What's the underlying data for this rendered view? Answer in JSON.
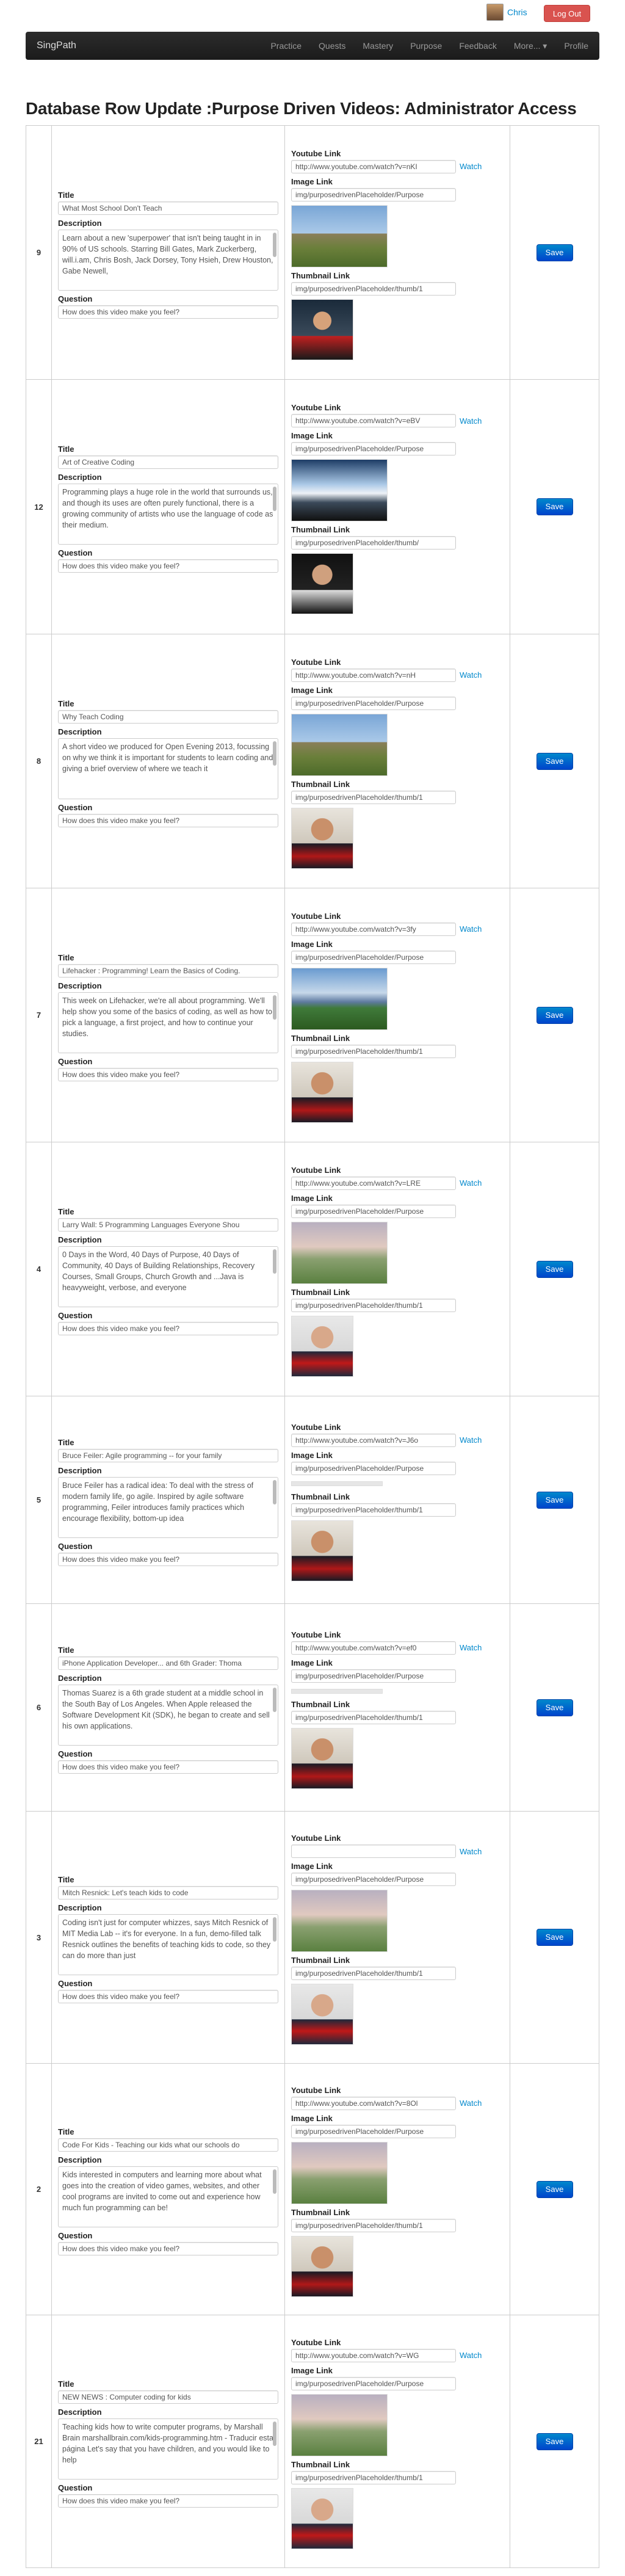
{
  "user": {
    "name": "Chris",
    "logout_label": "Log Out"
  },
  "nav": {
    "brand": "SingPath",
    "items": [
      "Practice",
      "Quests",
      "Mastery",
      "Purpose",
      "Feedback",
      "More... ▾",
      "Profile"
    ]
  },
  "page_title": "Database Row Update :Purpose Driven Videos: Administrator Access",
  "labels": {
    "title": "Title",
    "description": "Description",
    "question": "Question",
    "youtube": "Youtube Link",
    "image": "Image Link",
    "thumbnail": "Thumbnail Link",
    "watch": "Watch",
    "save": "Save"
  },
  "rows": [
    {
      "id": "9",
      "title": "What Most School Don't Teach",
      "description": "Learn about a new 'superpower' that isn't being taught in in 90% of US schools. Starring Bill Gates, Mark Zuckerberg, will.i.am, Chris Bosh, Jack Dorsey, Tony Hsieh, Drew Houston, Gabe Newell,",
      "question": "How does this video make you feel?",
      "youtube": "http://www.youtube.com/watch?v=nKI",
      "image": "img/purposedrivenPlaceholder/Purpose",
      "thumbnail": "img/purposedrivenPlaceholder/thumb/1",
      "image_state": "scene-a",
      "thumb_state": "p1"
    },
    {
      "id": "12",
      "title": "Art of Creative Coding",
      "description": "Programming plays a huge role in the world that surrounds us, and though its uses are often purely functional, there is a growing community of artists who use the language of code as their medium.",
      "question": "How does this video make you feel?",
      "youtube": "http://www.youtube.com/watch?v=eBV",
      "image": "img/purposedrivenPlaceholder/Purpose",
      "thumbnail": "img/purposedrivenPlaceholder/thumb/",
      "image_state": "scene-b",
      "thumb_state": "p2"
    },
    {
      "id": "8",
      "title": "Why Teach Coding",
      "description": "A short video we produced for Open Evening 2013, focussing on why we think it is important for students to learn coding and giving a brief overview of where we teach it",
      "question": "How does this video make you feel?",
      "youtube": "http://www.youtube.com/watch?v=nH",
      "image": "img/purposedrivenPlaceholder/Purpose",
      "thumbnail": "img/purposedrivenPlaceholder/thumb/1",
      "image_state": "scene-a",
      "thumb_state": "p3"
    },
    {
      "id": "7",
      "title": "Lifehacker : Programming! Learn the Basics of Coding.",
      "description": "This week on Lifehacker, we're all about programming. We'll help show you some of the basics of coding, as well as how to pick a language, a first project, and how to continue your studies.",
      "question": "How does this video make you feel?",
      "youtube": "http://www.youtube.com/watch?v=3fy",
      "image": "img/purposedrivenPlaceholder/Purpose",
      "thumbnail": "img/purposedrivenPlaceholder/thumb/1",
      "image_state": "scene-c",
      "thumb_state": "p3"
    },
    {
      "id": "4",
      "title": "Larry Wall: 5 Programming Languages Everyone Shou",
      "description": "0 Days in the Word, 40 Days of Purpose, 40 Days of Community, 40 Days of Building Relationships, Recovery Courses, Small Groups, Church Growth and ...Java is heavyweight, verbose, and everyone",
      "question": "How does this video make you feel?",
      "youtube": "http://www.youtube.com/watch?v=LRE",
      "image": "img/purposedrivenPlaceholder/Purpose",
      "thumbnail": "img/purposedrivenPlaceholder/thumb/1",
      "image_state": "scene-d",
      "thumb_state": "p4"
    },
    {
      "id": "5",
      "title": "Bruce Feiler: Agile programming -- for your family",
      "description": "Bruce Feiler has a radical idea: To deal with the stress of modern family life, go agile. Inspired by agile software programming, Feiler introduces family practices which encourage flexibility, bottom-up idea",
      "question": "How does this video make you feel?",
      "youtube": "http://www.youtube.com/watch?v=J6o",
      "image": "img/purposedrivenPlaceholder/Purpose",
      "thumbnail": "img/purposedrivenPlaceholder/thumb/1",
      "image_state": "placeholder",
      "thumb_state": "p3"
    },
    {
      "id": "6",
      "title": "iPhone Application Developer... and 6th Grader: Thoma",
      "description": "Thomas Suarez is a 6th grade student at a middle school in the South Bay of Los Angeles. When Apple released the Software Development Kit (SDK), he began to create and sell his own applications.",
      "question": "How does this video make you feel?",
      "youtube": "http://www.youtube.com/watch?v=ef0",
      "image": "img/purposedrivenPlaceholder/Purpose",
      "thumbnail": "img/purposedrivenPlaceholder/thumb/1",
      "image_state": "placeholder",
      "thumb_state": "p3"
    },
    {
      "id": "3",
      "title": "Mitch Resnick: Let's teach kids to code",
      "description": "Coding isn't just for computer whizzes, says Mitch Resnick of MIT Media Lab -- it's for everyone. In a fun, demo-filled talk Resnick outlines the benefits of teaching kids to code, so they can do more than just",
      "question": "How does this video make you feel?",
      "youtube": "",
      "image": "img/purposedrivenPlaceholder/Purpose",
      "thumbnail": "img/purposedrivenPlaceholder/thumb/1",
      "image_state": "scene-d",
      "thumb_state": "p4"
    },
    {
      "id": "2",
      "title": "Code For Kids - Teaching our kids what our schools do",
      "description": "Kids interested in computers and learning more about what goes into the creation of video games, websites, and other cool programs are invited to come out and experience how much fun programming can be!",
      "question": "How does this video make you feel?",
      "youtube": "http://www.youtube.com/watch?v=8Ol",
      "image": "img/purposedrivenPlaceholder/Purpose",
      "thumbnail": "img/purposedrivenPlaceholder/thumb/1",
      "image_state": "scene-d",
      "thumb_state": "p3"
    },
    {
      "id": "21",
      "title": "NEW NEWS : Computer coding for kids",
      "description": "Teaching kids how to write computer programs, by Marshall Brain marshallbrain.com/kids-programming.htm - Traducir esta página Let's say that you have children, and you would like to help",
      "question": "How does this video make you feel?",
      "youtube": "http://www.youtube.com/watch?v=WG",
      "image": "img/purposedrivenPlaceholder/Purpose",
      "thumbnail": "img/purposedrivenPlaceholder/thumb/1",
      "image_state": "scene-d",
      "thumb_state": "p4"
    }
  ]
}
